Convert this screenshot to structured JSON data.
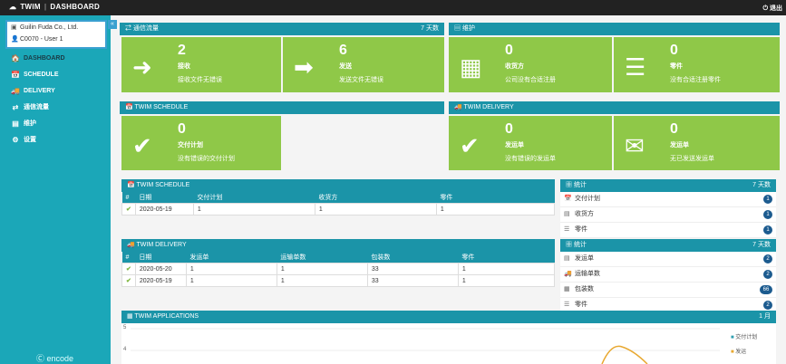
{
  "topbar": {
    "app": "TWIM",
    "sep": "|",
    "title": "DASHBOARD",
    "logout": "⏻ 退出"
  },
  "account": {
    "company": "Guilin Fuda Co., Ltd.",
    "user": "C0070 - User 1",
    "collapse_icon": "«"
  },
  "nav": [
    {
      "icon": "🏠",
      "label": "DASHBOARD",
      "active": true
    },
    {
      "icon": "📅",
      "label": "SCHEDULE"
    },
    {
      "icon": "🚚",
      "label": "DELIVERY"
    },
    {
      "icon": "⇄",
      "label": "通信流量"
    },
    {
      "icon": "▤",
      "label": "维护"
    },
    {
      "icon": "⚙",
      "label": "设置"
    }
  ],
  "footer_brand": "encode",
  "comms": {
    "title": "⇄ 通信流量",
    "period": "7 天数",
    "tiles": [
      {
        "icon": "➜",
        "num": "2",
        "title": "接收",
        "sub": "接收文件无错误"
      },
      {
        "icon": "➡",
        "num": "6",
        "title": "发送",
        "sub": "发送文件无错误"
      }
    ]
  },
  "maint": {
    "title": "▤ 维护",
    "tiles": [
      {
        "icon": "▦",
        "num": "0",
        "title": "收货方",
        "sub": "公司没有合适注册"
      },
      {
        "icon": "☰",
        "num": "0",
        "title": "零件",
        "sub": "没有合适注册零件"
      }
    ]
  },
  "sched_panel": {
    "title": "📅 TWIM SCHEDULE",
    "tile": {
      "icon": "✔",
      "num": "0",
      "title": "交付计划",
      "sub": "没有错误的交付计划"
    }
  },
  "deliv_panel": {
    "title": "🚚 TWIM DELIVERY",
    "tiles": [
      {
        "icon": "✔",
        "num": "0",
        "title": "发运单",
        "sub": "没有错误的发运单"
      },
      {
        "icon": "✉",
        "num": "0",
        "title": "发运单",
        "sub": "无已发送发运单"
      }
    ]
  },
  "sched_table": {
    "title": "📅 TWIM SCHEDULE",
    "headers": [
      "#",
      "日期",
      "交付计划",
      "收货方",
      "零件"
    ],
    "rows": [
      [
        "✔",
        "2020-05-19",
        "1",
        "1",
        "1"
      ]
    ]
  },
  "deliv_table": {
    "title": "🚚 TWIM DELIVERY",
    "headers": [
      "#",
      "日期",
      "发运单",
      "运输单数",
      "包装数",
      "零件"
    ],
    "rows": [
      [
        "✔",
        "2020-05-20",
        "1",
        "1",
        "33",
        "1"
      ],
      [
        "✔",
        "2020-05-19",
        "1",
        "1",
        "33",
        "1"
      ]
    ]
  },
  "stats1": {
    "title": "▦ 统计",
    "period": "7 天数",
    "rows": [
      {
        "icon": "📅",
        "label": "交付计划",
        "count": "1"
      },
      {
        "icon": "▤",
        "label": "收货方",
        "count": "1"
      },
      {
        "icon": "☰",
        "label": "零件",
        "count": "1"
      }
    ]
  },
  "stats2": {
    "title": "▦ 统计",
    "period": "7 天数",
    "rows": [
      {
        "icon": "▤",
        "label": "发运单",
        "count": "2"
      },
      {
        "icon": "🚚",
        "label": "运输单数",
        "count": "2"
      },
      {
        "icon": "▦",
        "label": "包装数",
        "count": "66"
      },
      {
        "icon": "☰",
        "label": "零件",
        "count": "2"
      }
    ]
  },
  "apps": {
    "title": "▦ TWIM APPLICATIONS",
    "period": "1 月",
    "y_ticks": [
      "5",
      "4"
    ],
    "legend": [
      "交付计划",
      "发运"
    ],
    "colors": {
      "series1": "#2f9fb0",
      "series2": "#e8a830"
    }
  }
}
